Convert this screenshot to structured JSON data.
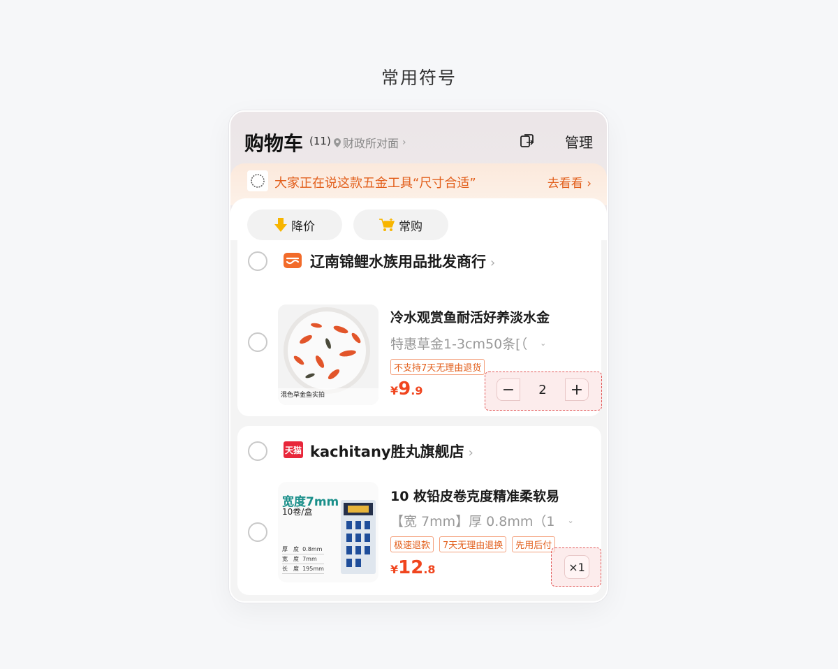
{
  "page": {
    "heading": "常用符号"
  },
  "header": {
    "title": "购物车",
    "count": "(11)",
    "location": "财政所对面",
    "manage_label": "管理"
  },
  "banner": {
    "text": "大家正在说这款五金工具“尺寸合适”",
    "action": "去看看"
  },
  "filters": [
    {
      "label": "降价",
      "icon": "down-arrow-icon"
    },
    {
      "label": "常购",
      "icon": "cart-icon"
    }
  ],
  "shops": [
    {
      "name": "辽南锦鲤水族用品批发商行",
      "badge": "store-icon",
      "item": {
        "title": "冷水观赏鱼耐活好养淡水金",
        "sku": "特惠草金1-3cm50条[（",
        "tags": [
          "不支持7天无理由退货"
        ],
        "price_int": "9",
        "price_dec": ".9",
        "currency": "¥",
        "image_caption": "混色草金鱼实拍",
        "quantity": "2"
      }
    },
    {
      "name": "kachitany胜丸旗舰店",
      "badge": "天猫",
      "item": {
        "title": "10 枚铅皮卷克度精准柔软易",
        "sku": "【宽 7mm】厚 0.8mm（1",
        "tags": [
          "极速退款",
          "7天无理由退换",
          "先用后付"
        ],
        "price_int": "12",
        "price_dec": ".8",
        "currency": "¥",
        "image_headline": "宽度7mm",
        "image_sub": "10卷/盒",
        "image_specs": [
          {
            "k": "厚　度",
            "v": "0.8mm"
          },
          {
            "k": "宽　度",
            "v": "7mm"
          },
          {
            "k": "长　度",
            "v": "195mm"
          }
        ],
        "quantity_label": "×1"
      }
    }
  ],
  "colors": {
    "accent": "#f0451e",
    "banner_text": "#e25f1c",
    "tmall": "#e8263a",
    "store": "#f26b2a"
  }
}
